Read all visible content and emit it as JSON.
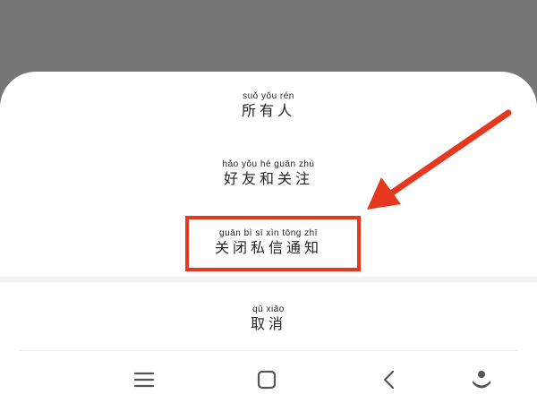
{
  "share_sheet": {
    "options": [
      {
        "pinyin": "suǒ yǒu rén",
        "label": "所有人"
      },
      {
        "pinyin": "hǎo yǒu hé guān zhù",
        "label": "好友和关注"
      },
      {
        "pinyin": "guān bì sī xìn tōng zhī",
        "label": "关闭私信通知"
      }
    ],
    "cancel": {
      "pinyin": "qǔ xiāo",
      "label": "取消"
    }
  },
  "annotation": {
    "highlight_color": "#e5381f",
    "arrow_color": "#e5381f"
  },
  "navbar": {
    "icons": [
      "menu-icon",
      "home-icon",
      "back-icon",
      "assistant-icon"
    ]
  }
}
